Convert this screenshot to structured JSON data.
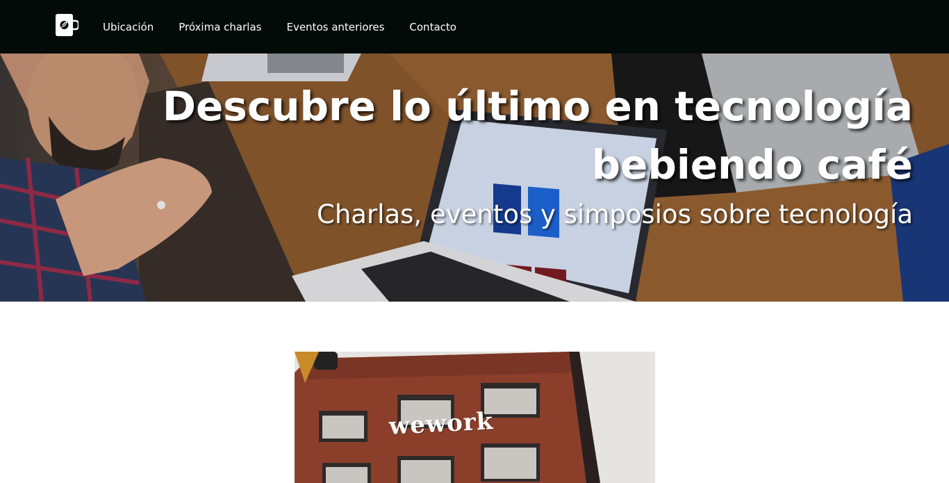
{
  "nav": {
    "logo_icon": "coffee-cup-leaf-icon",
    "links": [
      "Ubicación",
      "Próxima charlas",
      "Eventos anteriores",
      "Contacto"
    ]
  },
  "hero": {
    "title_line1": "Descubre lo último en tecnología",
    "title_line2": "bebiendo café",
    "subtitle": "Charlas, eventos y simposios sobre tecnología"
  },
  "content": {
    "building_sign": "wework"
  },
  "colors": {
    "navbar_bg": "#030b08",
    "text": "#ffffff",
    "page_bg": "#ffffff"
  }
}
